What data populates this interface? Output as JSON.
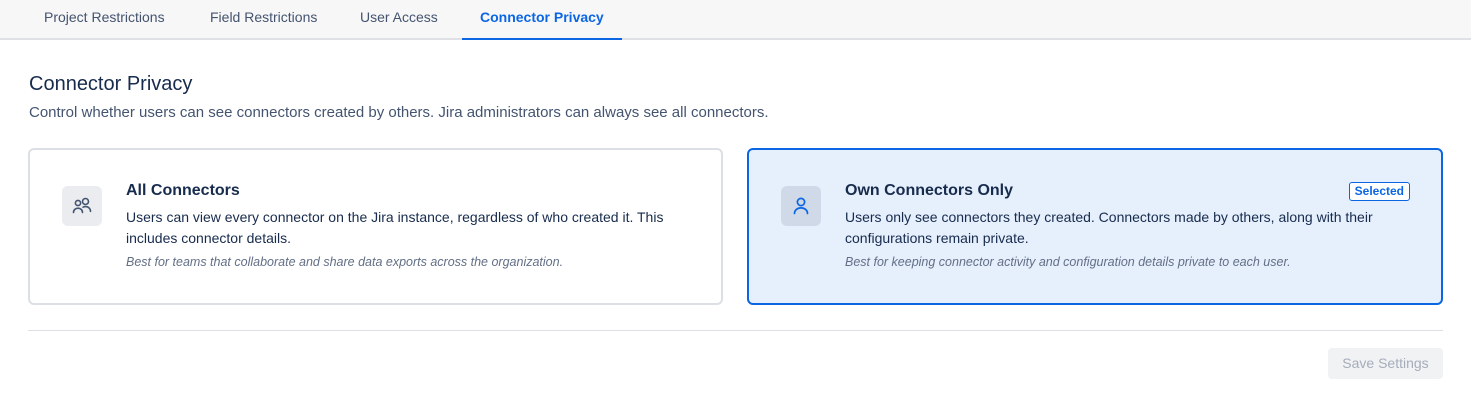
{
  "tabs": [
    {
      "label": "Project Restrictions",
      "active": false
    },
    {
      "label": "Field Restrictions",
      "active": false
    },
    {
      "label": "User Access",
      "active": false
    },
    {
      "label": "Connector Privacy",
      "active": true
    }
  ],
  "section": {
    "title": "Connector Privacy",
    "description": "Control whether users can see connectors created by others. Jira administrators can always see all connectors."
  },
  "options": [
    {
      "icon": "users-icon",
      "title": "All Connectors",
      "body": "Users can view every connector on the Jira instance, regardless of who created it. This includes connector details.",
      "note": "Best for teams that collaborate and share data exports across the organization.",
      "selected": false
    },
    {
      "icon": "user-icon",
      "title": "Own Connectors Only",
      "body": "Users only see connectors they created. Connectors made by others, along with their configurations remain private.",
      "note": "Best for keeping connector activity and configuration details private to each user.",
      "selected": true,
      "badge": "Selected"
    }
  ],
  "footer": {
    "save_label": "Save Settings",
    "save_enabled": false
  },
  "colors": {
    "accent": "#0c66e4",
    "selected_bg": "#e6effc",
    "muted_text": "#44546f"
  }
}
